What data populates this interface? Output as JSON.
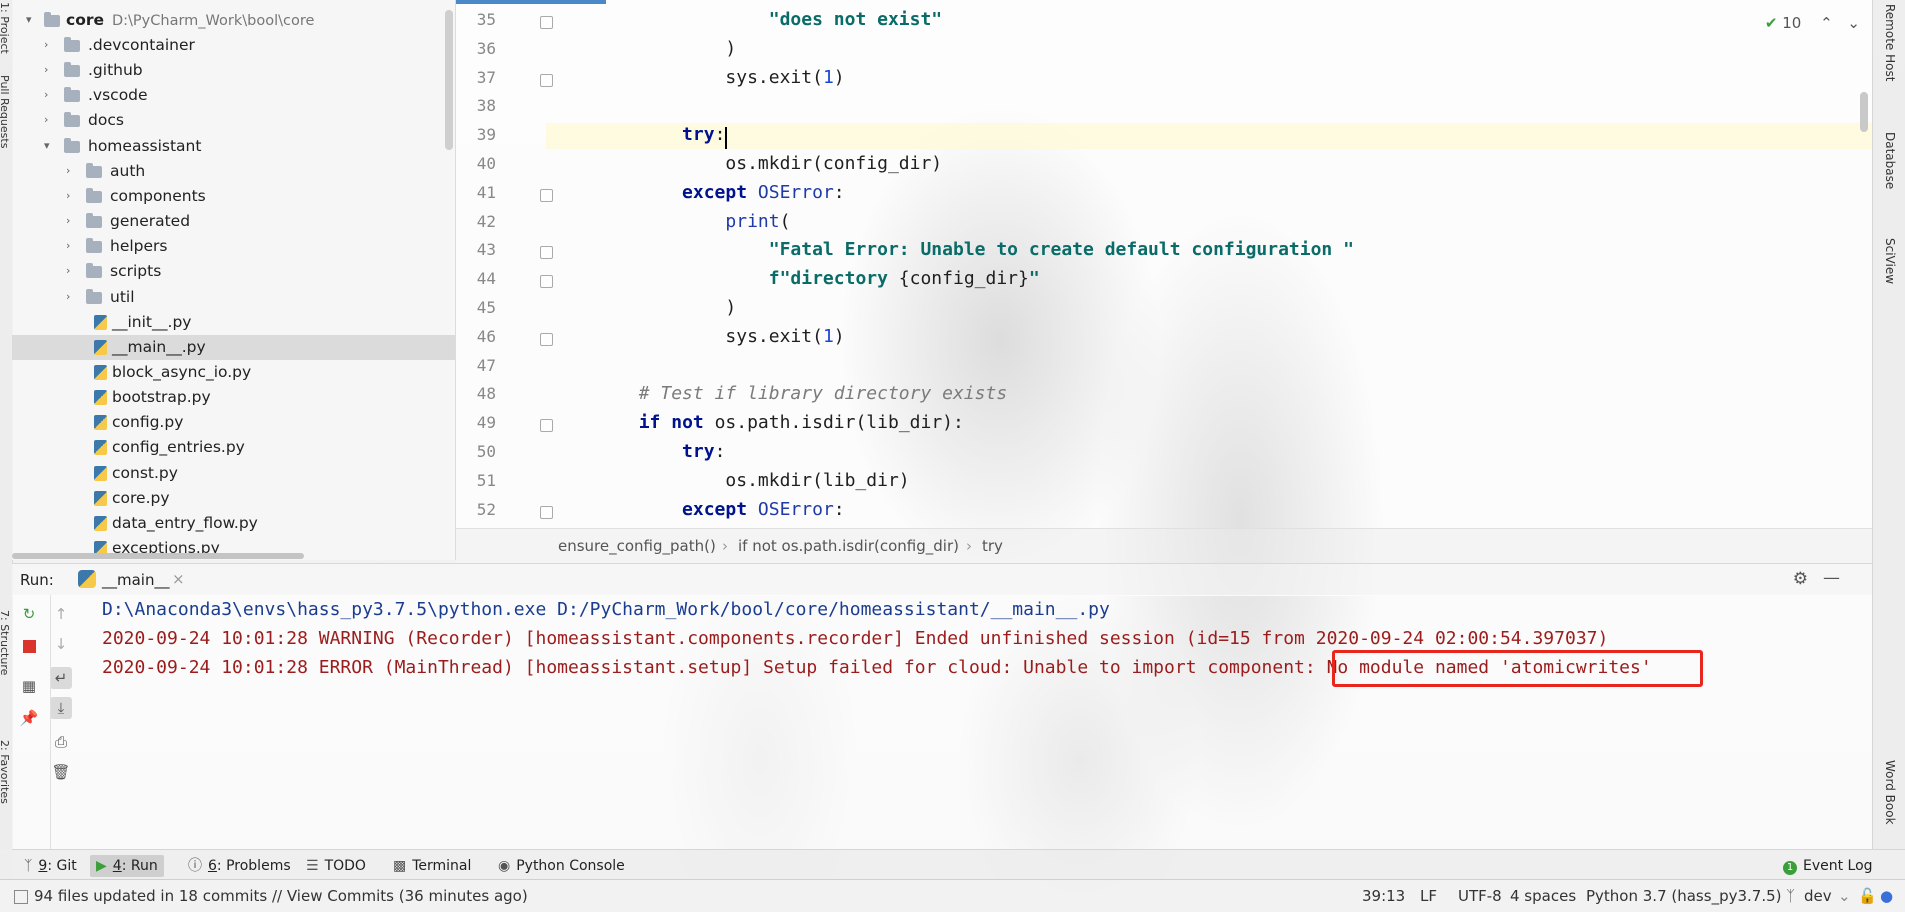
{
  "sidebar_left": {
    "labels": [
      "1: Project",
      "Pull Requests",
      "7: Structure",
      "2: Favorites"
    ]
  },
  "project_tree": {
    "root": {
      "name": "core",
      "path": "D:\\PyCharm_Work\\bool\\core"
    },
    "items": [
      {
        "label": ".devcontainer",
        "type": "folder",
        "depth": 1
      },
      {
        "label": ".github",
        "type": "folder",
        "depth": 1
      },
      {
        "label": ".vscode",
        "type": "folder",
        "depth": 1
      },
      {
        "label": "docs",
        "type": "folder",
        "depth": 1
      },
      {
        "label": "homeassistant",
        "type": "folder",
        "depth": 1,
        "expanded": true
      },
      {
        "label": "auth",
        "type": "folder",
        "depth": 2
      },
      {
        "label": "components",
        "type": "folder",
        "depth": 2
      },
      {
        "label": "generated",
        "type": "folder",
        "depth": 2
      },
      {
        "label": "helpers",
        "type": "folder",
        "depth": 2
      },
      {
        "label": "scripts",
        "type": "folder",
        "depth": 2
      },
      {
        "label": "util",
        "type": "folder",
        "depth": 2
      },
      {
        "label": "__init__.py",
        "type": "file",
        "depth": 2
      },
      {
        "label": "__main__.py",
        "type": "file",
        "depth": 2,
        "selected": true
      },
      {
        "label": "block_async_io.py",
        "type": "file",
        "depth": 2
      },
      {
        "label": "bootstrap.py",
        "type": "file",
        "depth": 2
      },
      {
        "label": "config.py",
        "type": "file",
        "depth": 2
      },
      {
        "label": "config_entries.py",
        "type": "file",
        "depth": 2
      },
      {
        "label": "const.py",
        "type": "file",
        "depth": 2
      },
      {
        "label": "core.py",
        "type": "file",
        "depth": 2
      },
      {
        "label": "data_entry_flow.py",
        "type": "file",
        "depth": 2
      },
      {
        "label": "exceptions.py",
        "type": "file",
        "depth": 2
      }
    ]
  },
  "editor": {
    "inspection_count": "10",
    "caret_line": 39,
    "lines": [
      {
        "n": "35",
        "tokens": [
          {
            "t": "                    "
          },
          {
            "t": "\"does not exist\"",
            "c": "str"
          }
        ]
      },
      {
        "n": "36",
        "tokens": [
          {
            "t": "                )"
          }
        ]
      },
      {
        "n": "37",
        "tokens": [
          {
            "t": "                sys.exit("
          },
          {
            "t": "1",
            "c": "num"
          },
          {
            "t": ")"
          }
        ]
      },
      {
        "n": "38",
        "tokens": []
      },
      {
        "n": "39",
        "tokens": [
          {
            "t": "            "
          },
          {
            "t": "try",
            "c": "kw"
          },
          {
            "t": ":"
          }
        ]
      },
      {
        "n": "40",
        "tokens": [
          {
            "t": "                os.mkdir(config_dir)"
          }
        ]
      },
      {
        "n": "41",
        "tokens": [
          {
            "t": "            "
          },
          {
            "t": "except",
            "c": "kw"
          },
          {
            "t": " "
          },
          {
            "t": "OSError",
            "c": "cls"
          },
          {
            "t": ":"
          }
        ]
      },
      {
        "n": "42",
        "tokens": [
          {
            "t": "                "
          },
          {
            "t": "print",
            "c": "cls"
          },
          {
            "t": "("
          }
        ]
      },
      {
        "n": "43",
        "tokens": [
          {
            "t": "                    "
          },
          {
            "t": "\"Fatal Error: Unable to create default configuration \"",
            "c": "str"
          }
        ]
      },
      {
        "n": "44",
        "tokens": [
          {
            "t": "                    "
          },
          {
            "t": "f\"directory ",
            "c": "str"
          },
          {
            "t": "{config_dir}"
          },
          {
            "t": "\"",
            "c": "str"
          }
        ]
      },
      {
        "n": "45",
        "tokens": [
          {
            "t": "                )"
          }
        ]
      },
      {
        "n": "46",
        "tokens": [
          {
            "t": "                sys.exit("
          },
          {
            "t": "1",
            "c": "num"
          },
          {
            "t": ")"
          }
        ]
      },
      {
        "n": "47",
        "tokens": []
      },
      {
        "n": "48",
        "tokens": [
          {
            "t": "        "
          },
          {
            "t": "# Test if library directory exists",
            "c": "cmt"
          }
        ]
      },
      {
        "n": "49",
        "tokens": [
          {
            "t": "        "
          },
          {
            "t": "if",
            "c": "kw"
          },
          {
            "t": " "
          },
          {
            "t": "not",
            "c": "kw"
          },
          {
            "t": " os.path.isdir(lib_dir):"
          }
        ]
      },
      {
        "n": "50",
        "tokens": [
          {
            "t": "            "
          },
          {
            "t": "try",
            "c": "kw"
          },
          {
            "t": ":"
          }
        ]
      },
      {
        "n": "51",
        "tokens": [
          {
            "t": "                os.mkdir(lib_dir)"
          }
        ]
      },
      {
        "n": "52",
        "tokens": [
          {
            "t": "            "
          },
          {
            "t": "except",
            "c": "kw"
          },
          {
            "t": " "
          },
          {
            "t": "OSError",
            "c": "cls"
          },
          {
            "t": ":"
          }
        ]
      }
    ],
    "breadcrumbs": [
      "ensure_config_path()",
      "if not os.path.isdir(config_dir)",
      "try"
    ]
  },
  "sidebar_right": {
    "labels": [
      "Remote Host",
      "Database",
      "SciView",
      "Word Book"
    ]
  },
  "run": {
    "title": "Run:",
    "tab_label": "__main__",
    "output": [
      {
        "text": "D:\\Anaconda3\\envs\\hass_py3.7.5\\python.exe D:/PyCharm_Work/bool/core/homeassistant/__main__.py",
        "kind": "cmd"
      },
      {
        "text": "2020-09-24 10:01:28 WARNING (Recorder) [homeassistant.components.recorder] Ended unfinished session (id=15 from 2020-09-24 02:00:54.397037)",
        "kind": "err"
      },
      {
        "text": "2020-09-24 10:01:28 ERROR (MainThread) [homeassistant.setup] Setup failed for cloud: Unable to import component: No module named 'atomicwrites'",
        "kind": "err"
      }
    ],
    "highlighted_text": "No module named 'atomicwrites'"
  },
  "tool_tabs": [
    {
      "key": "9",
      "label": ": Git",
      "icon": "git-branch-icon"
    },
    {
      "key": "4",
      "label": ": Run",
      "icon": "run-icon",
      "active": true
    },
    {
      "key": "6",
      "label": ": Problems",
      "icon": "problems-icon"
    },
    {
      "key": "",
      "label": "TODO",
      "icon": "todo-icon"
    },
    {
      "key": "",
      "label": "Terminal",
      "icon": "terminal-icon"
    },
    {
      "key": "",
      "label": "Python Console",
      "icon": "python-console-icon"
    }
  ],
  "event_log": "Event Log",
  "status": {
    "message": "94 files updated in 18 commits // View Commits (36 minutes ago)",
    "position": "39:13",
    "line_sep": "LF",
    "encoding": "UTF-8",
    "indent": "4 spaces",
    "interpreter": "Python 3.7 (hass_py3.7.5)",
    "branch": "dev"
  },
  "colors": {
    "highlight_box": "#e8261e",
    "keyword": "#00138c",
    "string": "#0a6c68",
    "error_text": "#9b1c1c"
  }
}
